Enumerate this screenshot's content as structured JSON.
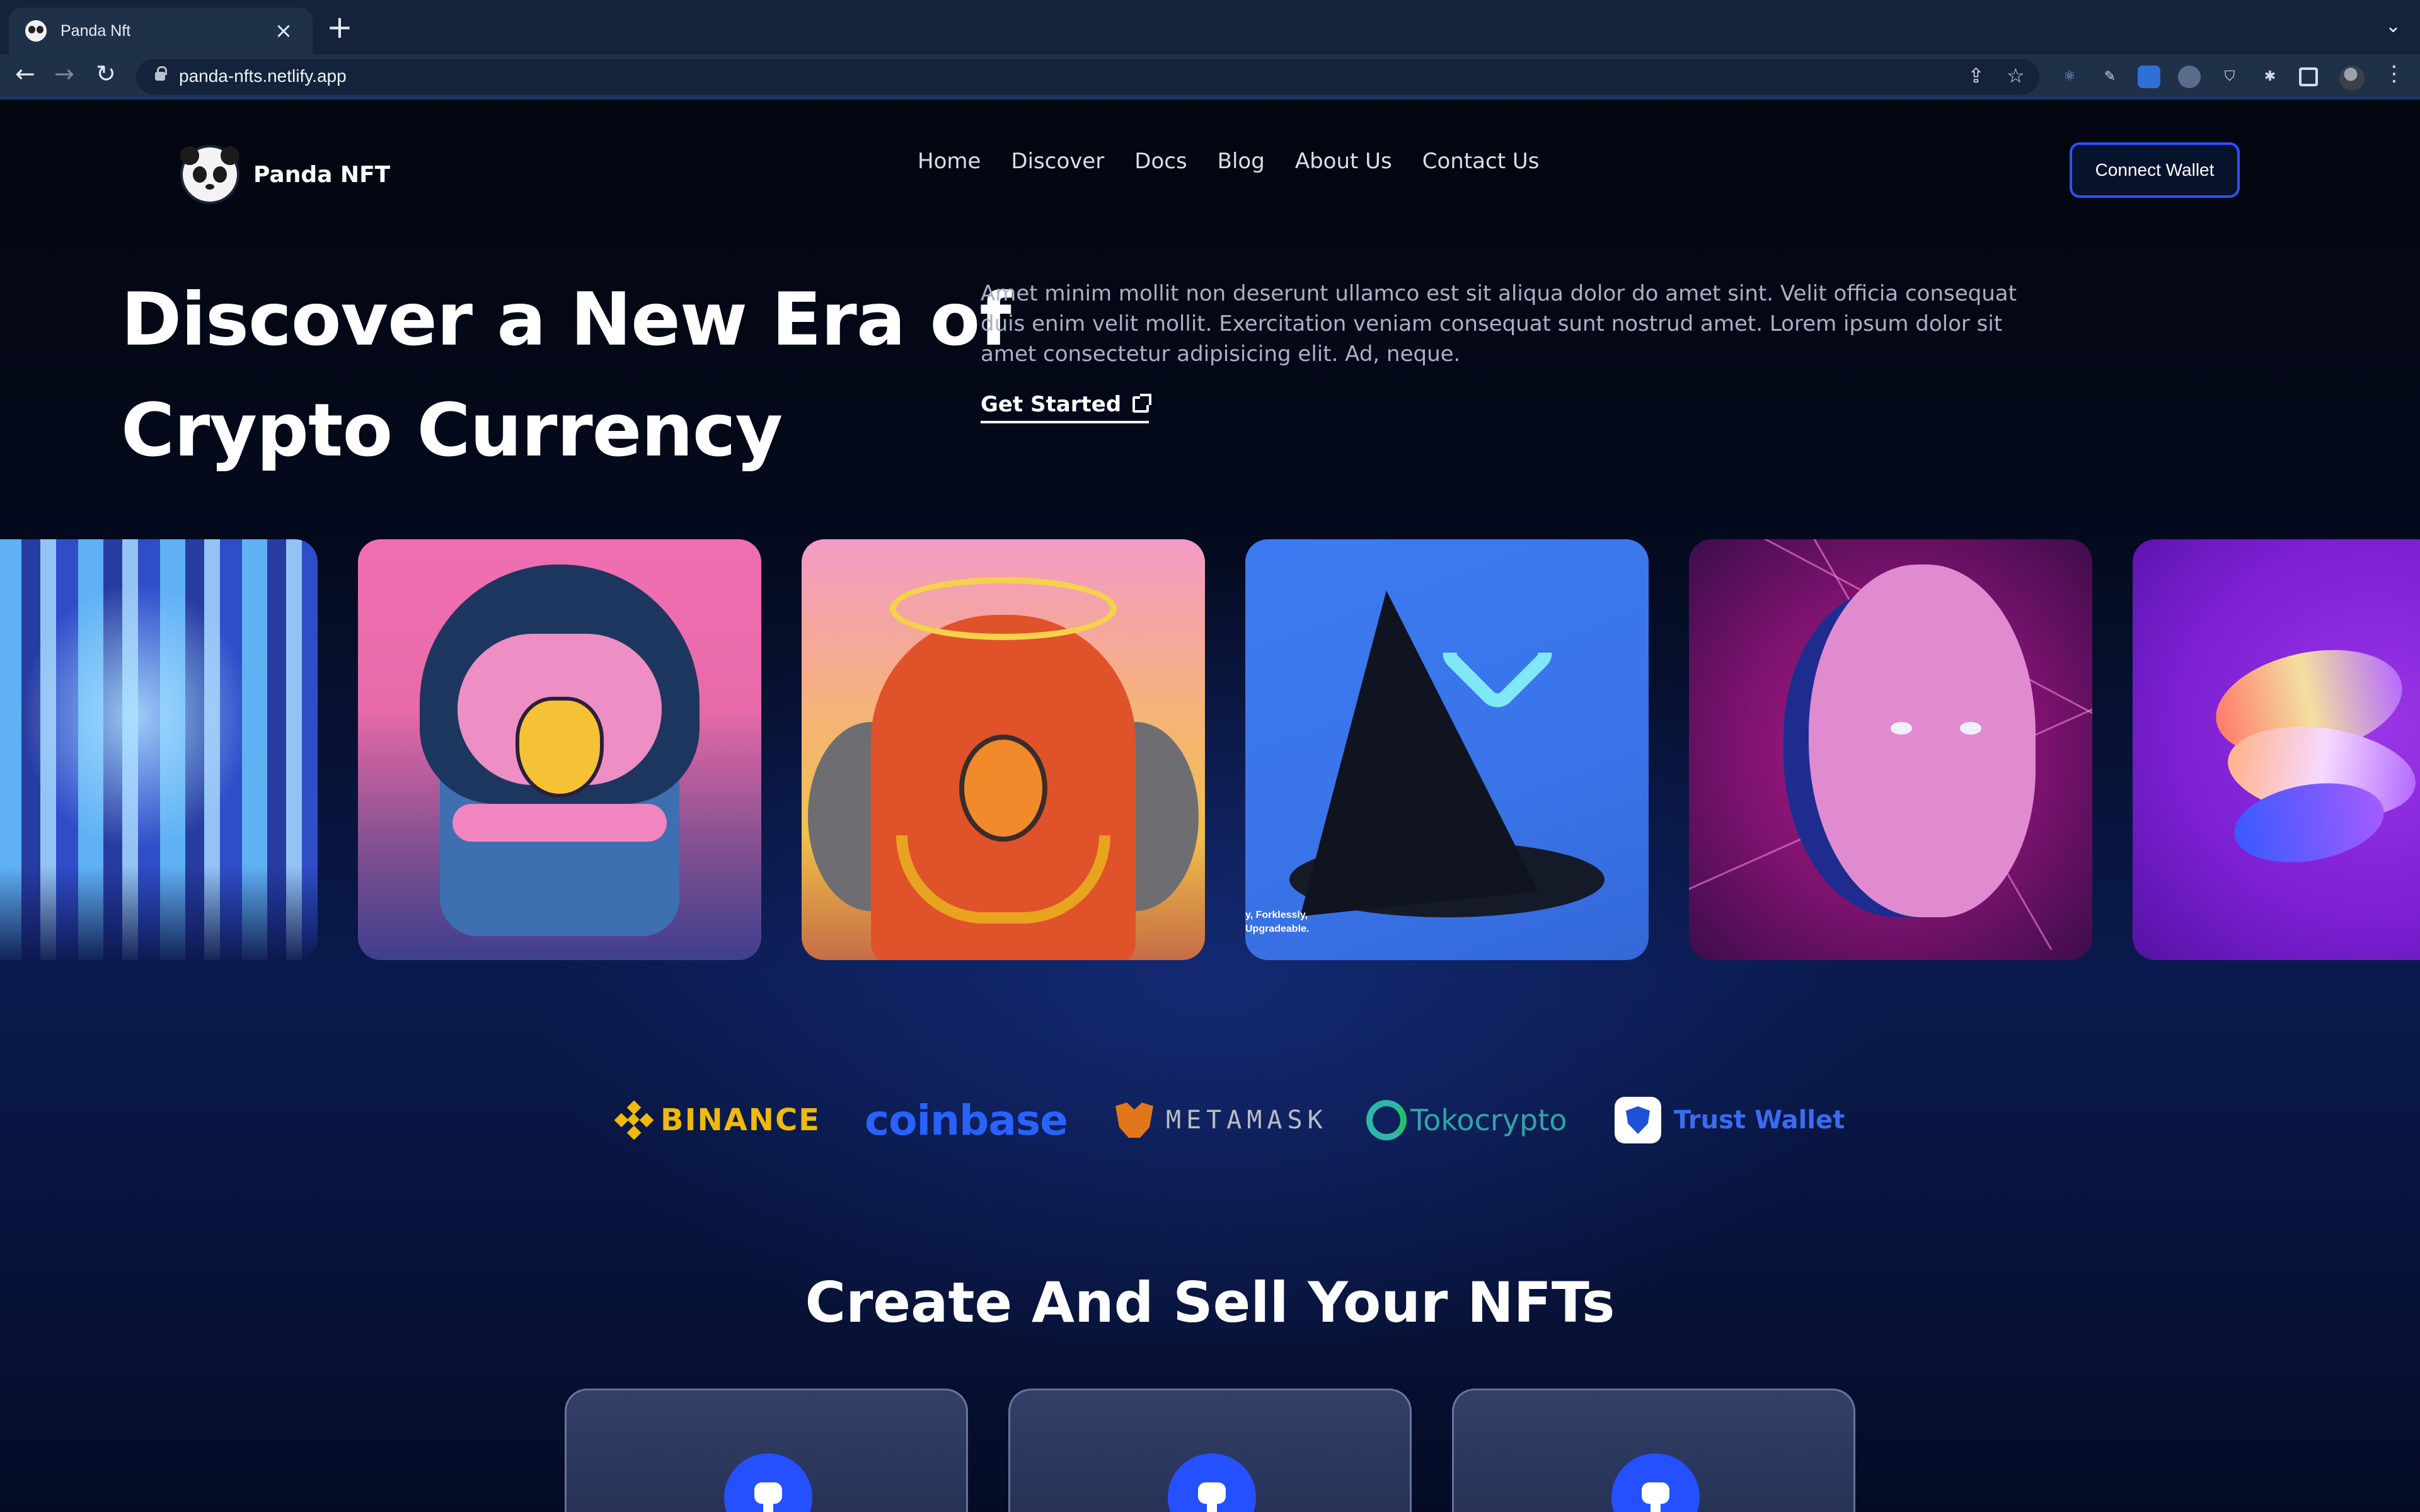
{
  "browser": {
    "tab_title": "Panda Nft",
    "tab_close": "×",
    "new_tab": "+",
    "url": "panda-nfts.netlify.app"
  },
  "header": {
    "brand_name": "Panda NFT",
    "nav": [
      "Home",
      "Discover",
      "Docs",
      "Blog",
      "About Us",
      "Contact Us"
    ],
    "connect_label": "Connect Wallet"
  },
  "hero": {
    "title_line1": "Discover a New Era of",
    "title_line2": "Crypto Currency",
    "description": "Amet minim mollit non deserunt ullamco est sit aliqua dolor do amet sint. Velit officia consequat duis enim velit mollit. Exercitation veniam consequat sunt nostrud amet. Lorem ipsum dolor sit amet consectetur adipisicing elit. Ad, neque.",
    "cta_label": "Get Started"
  },
  "nft_cards": [
    {
      "name": "diamond-helmet"
    },
    {
      "name": "blue-bird"
    },
    {
      "name": "red-bird"
    },
    {
      "name": "black-cone",
      "caption_line1": "y, Forklessly,",
      "caption_line2": "Upgradeable."
    },
    {
      "name": "pink-statue"
    },
    {
      "name": "purple-abstract"
    }
  ],
  "partners": [
    {
      "name": "binance",
      "label": "BINANCE",
      "color": "#f0b90b"
    },
    {
      "name": "coinbase",
      "label": "coinbase",
      "color": "#2962ff"
    },
    {
      "name": "metamask",
      "label": "METAMASK",
      "color": "#b8bcc6"
    },
    {
      "name": "tokocrypto",
      "label": "Tokocrypto",
      "color": "#2ea6a6"
    },
    {
      "name": "trust-wallet",
      "label": "Trust Wallet",
      "color": "#3a6cf0"
    }
  ],
  "section": {
    "title": "Create And Sell Your NFTs"
  },
  "colors": {
    "accent": "#2550ff",
    "background": "#050a1c"
  }
}
